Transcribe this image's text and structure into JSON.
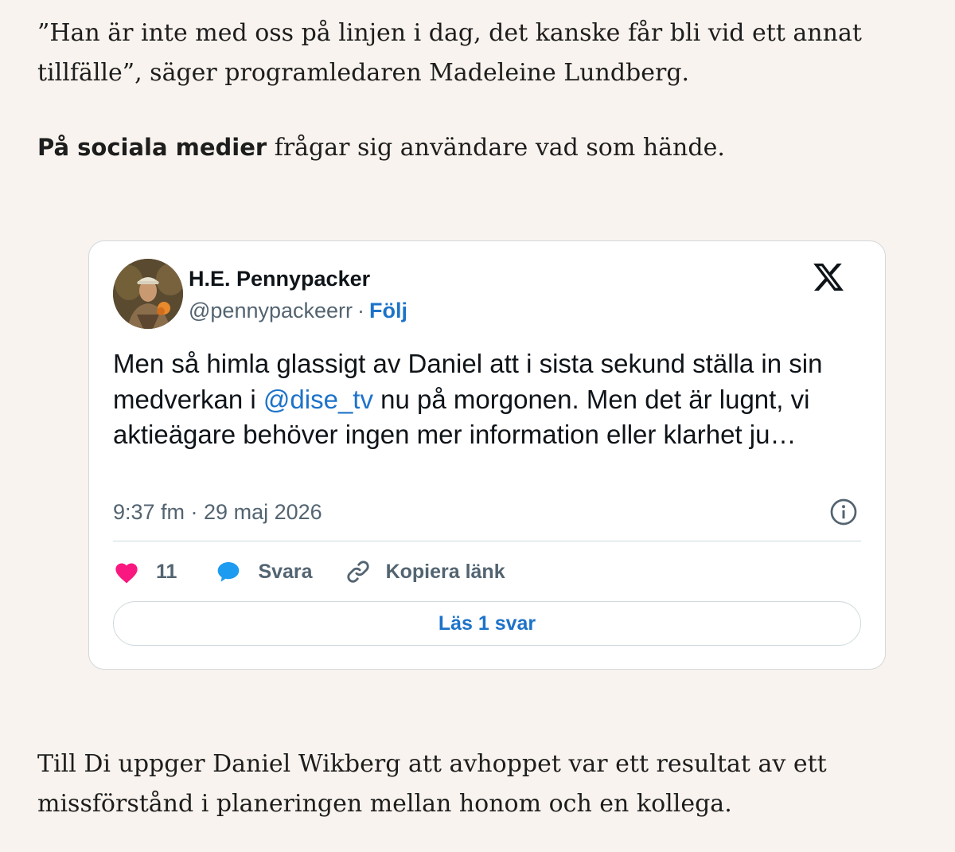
{
  "article": {
    "paragraph_1": "”Han är inte med oss på linjen i dag, det kanske får bli vid ett annat tillfälle”, säger programledaren Madeleine Lundberg.",
    "paragraph_2_lead": "På sociala medier",
    "paragraph_2_rest": " frågar sig användare vad som hände.",
    "paragraph_3": "Till Di uppger Daniel Wikberg att avhoppet var ett resultat av ett missförstånd i planeringen mellan honom och en kollega."
  },
  "tweet": {
    "author_name": "H.E. Pennypacker",
    "handle": "@pennypackeerr",
    "separator": "·",
    "follow_label": "Följ",
    "text_part1": "Men så himla glassigt av Daniel att i sista sekund ställa in sin medverkan i ",
    "mention": "@dise_tv",
    "text_part2": " nu på morgonen. Men det är lugnt, vi aktieägare behöver ingen mer information eller klarhet ju…",
    "timestamp": "9:37 fm · 29 maj 2026",
    "like_count": "11",
    "reply_label": "Svara",
    "copy_link_label": "Kopiera länk",
    "read_replies_label": "Läs 1 svar",
    "icons": {
      "logo": "x-logo-icon",
      "info": "info-icon",
      "like": "heart-icon",
      "reply": "speech-bubble-icon",
      "copy": "link-icon"
    },
    "colors": {
      "link": "#1d73c9",
      "heart": "#f91880",
      "reply_bubble": "#1d9bf0",
      "muted_text": "#536471",
      "page_background": "#f8f3ee"
    }
  }
}
